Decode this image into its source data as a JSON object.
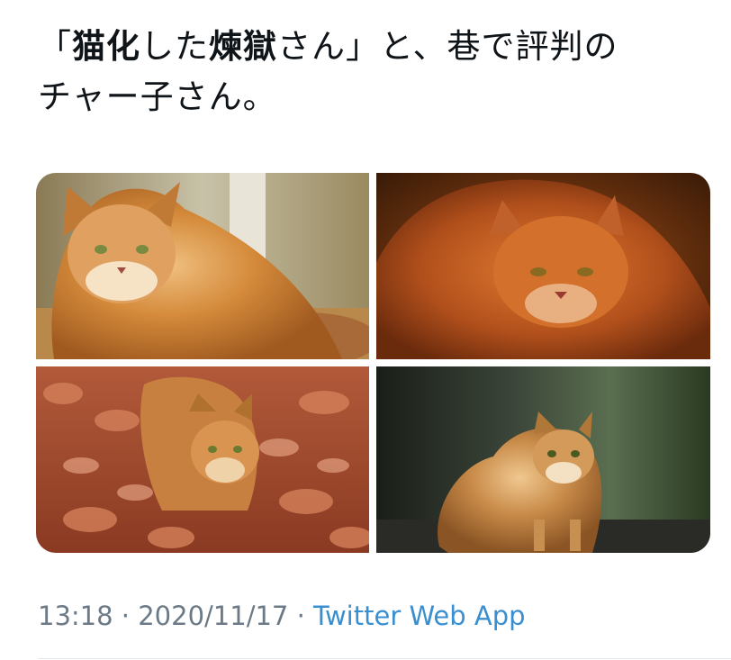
{
  "tweet": {
    "text_segments": [
      {
        "text": "「",
        "bold": false
      },
      {
        "text": "猫化",
        "bold": true
      },
      {
        "text": "した",
        "bold": false
      },
      {
        "text": "煉獄",
        "bold": true
      },
      {
        "text": "さん」と、巷で評判の",
        "bold": false
      },
      {
        "text": "チャー子さん。",
        "bold": false
      }
    ]
  },
  "media": {
    "photos": [
      {
        "name": "photo-cat-sitting"
      },
      {
        "name": "photo-cat-closeup"
      },
      {
        "name": "photo-cat-leaves"
      },
      {
        "name": "photo-cat-walking"
      }
    ]
  },
  "meta": {
    "time": "13:18",
    "sep1": " · ",
    "date": "2020/11/17",
    "sep2": " · ",
    "source": "Twitter Web App"
  },
  "colors": {
    "text": "#0f1419",
    "meta": "#6b7a86",
    "link": "#3a8fd0",
    "divider": "#e1e8ed"
  }
}
